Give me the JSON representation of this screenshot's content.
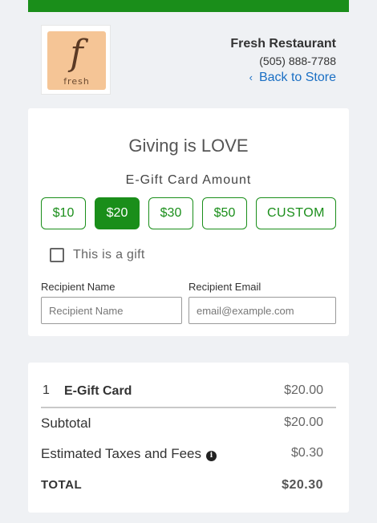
{
  "header": {
    "logo_script": "f",
    "logo_word": "fresh",
    "store_name": "Fresh Restaurant",
    "store_phone": "(505) 888-7788",
    "back_label": "Back to Store"
  },
  "giftcard": {
    "headline": "Giving is LOVE",
    "amount_label": "E-Gift Card Amount",
    "amounts": [
      "$10",
      "$20",
      "$30",
      "$50",
      "CUSTOM"
    ],
    "selected_amount": "$20",
    "is_gift_label": "This is a gift",
    "is_gift_checked": false,
    "recipient_name_label": "Recipient Name",
    "recipient_name_placeholder": "Recipient Name",
    "recipient_email_label": "Recipient Email",
    "recipient_email_placeholder": "email@example.com"
  },
  "summary": {
    "item": {
      "qty": "1",
      "name": "E-Gift Card",
      "price": "$20.00"
    },
    "subtotal_label": "Subtotal",
    "subtotal_value": "$20.00",
    "tax_label": "Estimated Taxes and Fees",
    "tax_value": "$0.30",
    "total_label": "TOTAL",
    "total_value": "$20.30"
  },
  "colors": {
    "accent": "#1a8e1a",
    "link": "#1a6fc4",
    "logo_bg": "#f5c596"
  }
}
